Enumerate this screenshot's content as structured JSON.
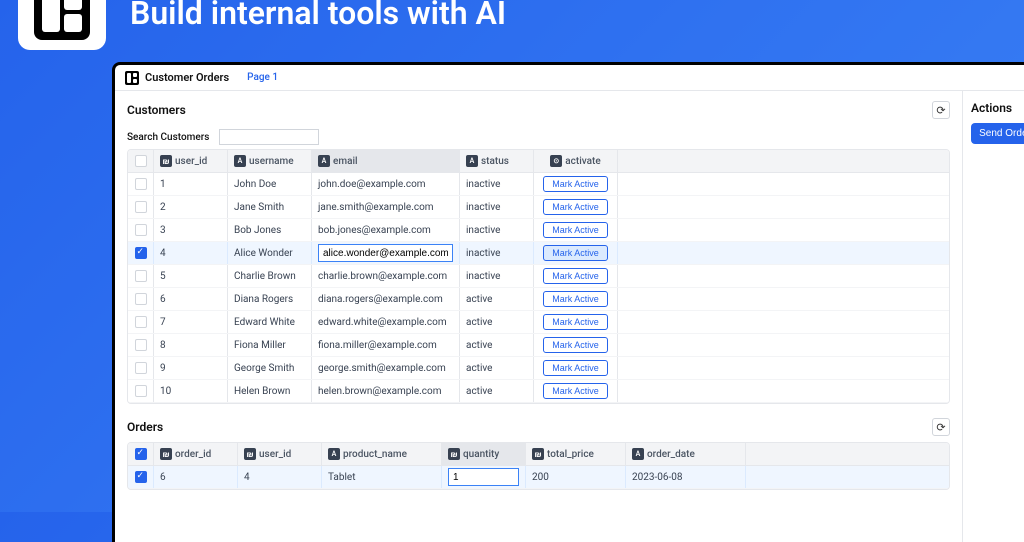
{
  "hero": {
    "title": "Build internal tools with AI"
  },
  "titlebar": {
    "app_name": "Customer Orders",
    "tab": "Page 1"
  },
  "customers": {
    "title": "Customers",
    "search_label": "Search Customers",
    "columns": {
      "c0": "user_id",
      "c1": "username",
      "c2": "email",
      "c3": "status",
      "c4": "activate"
    },
    "mark_active": "Mark Active",
    "rows": [
      {
        "id": "1",
        "username": "John Doe",
        "email": "john.doe@example.com",
        "status": "inactive",
        "selected": false
      },
      {
        "id": "2",
        "username": "Jane Smith",
        "email": "jane.smith@example.com",
        "status": "inactive",
        "selected": false
      },
      {
        "id": "3",
        "username": "Bob Jones",
        "email": "bob.jones@example.com",
        "status": "inactive",
        "selected": false
      },
      {
        "id": "4",
        "username": "Alice Wonder",
        "email": "alice.wonder@example.com",
        "status": "inactive",
        "selected": true
      },
      {
        "id": "5",
        "username": "Charlie Brown",
        "email": "charlie.brown@example.com",
        "status": "inactive",
        "selected": false
      },
      {
        "id": "6",
        "username": "Diana Rogers",
        "email": "diana.rogers@example.com",
        "status": "active",
        "selected": false
      },
      {
        "id": "7",
        "username": "Edward White",
        "email": "edward.white@example.com",
        "status": "active",
        "selected": false
      },
      {
        "id": "8",
        "username": "Fiona Miller",
        "email": "fiona.miller@example.com",
        "status": "active",
        "selected": false
      },
      {
        "id": "9",
        "username": "George Smith",
        "email": "george.smith@example.com",
        "status": "active",
        "selected": false
      },
      {
        "id": "10",
        "username": "Helen Brown",
        "email": "helen.brown@example.com",
        "status": "active",
        "selected": false
      }
    ]
  },
  "orders": {
    "title": "Orders",
    "columns": {
      "c0": "order_id",
      "c1": "user_id",
      "c2": "product_name",
      "c3": "quantity",
      "c4": "total_price",
      "c5": "order_date"
    },
    "rows": [
      {
        "order_id": "6",
        "user_id": "4",
        "product_name": "Tablet",
        "quantity": "1",
        "total_price": "200",
        "order_date": "2023-06-08",
        "selected": true
      }
    ]
  },
  "actions": {
    "title": "Actions",
    "send": "Send Orders"
  }
}
